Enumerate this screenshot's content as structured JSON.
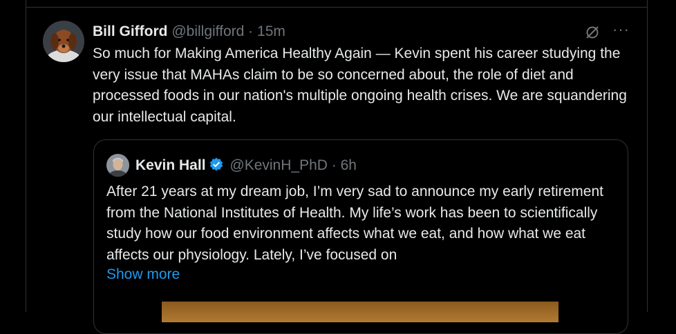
{
  "tweet": {
    "author_name": "Bill Gifford",
    "handle": "@billgifford",
    "separator": "·",
    "time": "15m",
    "more_label": "···",
    "text": "So much for Making America Healthy Again — Kevin spent his career studying the very issue that MAHAs claim to be so concerned about, the role of diet and processed foods in our nation's multiple ongoing health crises. We are squandering our intellectual capital."
  },
  "quote": {
    "author_name": "Kevin Hall",
    "handle": "@KevinH_PhD",
    "separator": "·",
    "time": "6h",
    "text": "After 21 years at my dream job, I’m very sad to announce my early retirement from the National Institutes of Health. My life’s work has been to scientifically study how our food environment affects what we eat, and how what we eat affects our physiology. Lately, I’ve focused on",
    "show_more_label": "Show more"
  },
  "icons": {
    "grok": "grok-icon",
    "more": "more-options-icon",
    "verified": "verified-badge-icon"
  },
  "colors": {
    "background": "#000000",
    "text": "#e7e9ea",
    "muted": "#71767b",
    "link": "#1d9bf0",
    "verified": "#1d9bf0",
    "border": "#2f3336"
  }
}
